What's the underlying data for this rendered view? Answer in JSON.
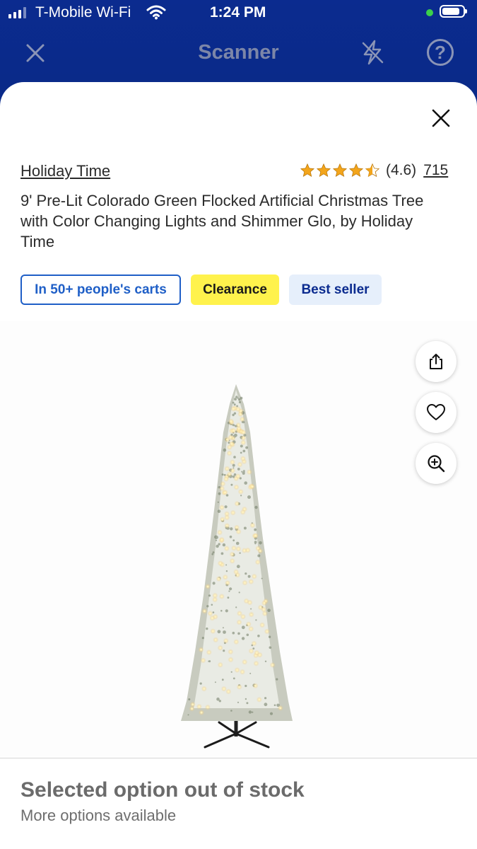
{
  "status_bar": {
    "carrier": "T-Mobile Wi-Fi",
    "time": "1:24 PM"
  },
  "header": {
    "title": "Scanner",
    "close_icon": "close-icon",
    "flash_icon": "flash-off-icon",
    "help_icon": "help-icon",
    "help_glyph": "?"
  },
  "product": {
    "brand": "Holiday Time",
    "rating_text": "(4.6)",
    "rating_value": 4.6,
    "review_count": "715",
    "title": "9' Pre-Lit Colorado Green Flocked Artificial Christmas Tree with Color Changing Lights and Shimmer Glo, by Holiday Time",
    "badges": {
      "carts": "In 50+ people's carts",
      "clearance": "Clearance",
      "best_seller": "Best seller"
    }
  },
  "actions": {
    "share_icon": "share-icon",
    "favorite_icon": "heart-icon",
    "zoom_icon": "zoom-in-icon"
  },
  "availability": {
    "title": "Selected option out of stock",
    "subtitle": "More options available"
  },
  "colors": {
    "header_bg": "#0b2b8f",
    "accent_blue": "#1f5fc7",
    "clearance_yellow": "#fff24c",
    "best_seller_bg": "#e6effb",
    "star": "#f3a51b"
  }
}
